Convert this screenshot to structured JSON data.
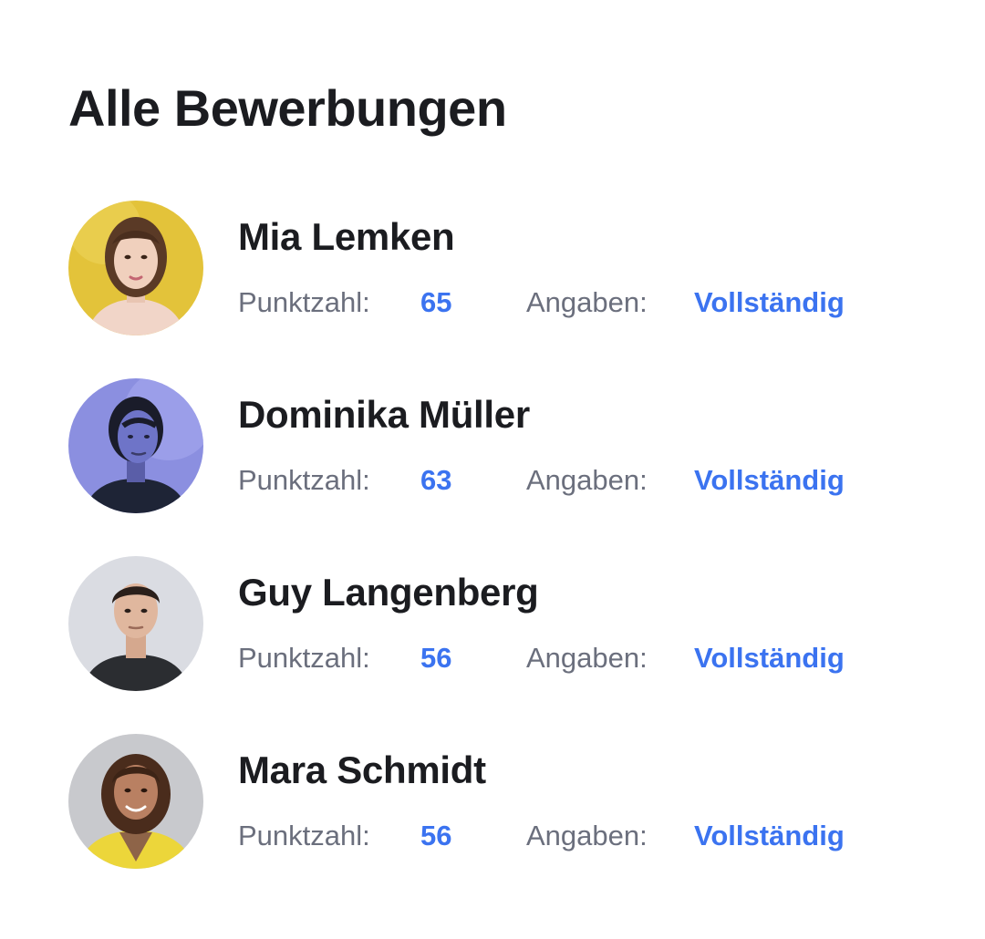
{
  "page_title": "Alle Bewerbungen",
  "colors": {
    "accent": "#3b73f0",
    "label": "#6b6f7d",
    "text": "#1b1c20"
  },
  "applications": [
    {
      "name": "Mia Lemken",
      "score_label": "Punktzahl:",
      "score": "65",
      "info_label": "Angaben:",
      "info_status": "Vollständig"
    },
    {
      "name": "Dominika Müller",
      "score_label": "Punktzahl:",
      "score": "63",
      "info_label": "Angaben:",
      "info_status": "Vollständig"
    },
    {
      "name": "Guy Langenberg",
      "score_label": "Punktzahl:",
      "score": "56",
      "info_label": "Angaben:",
      "info_status": "Vollständig"
    },
    {
      "name": "Mara Schmidt",
      "score_label": "Punktzahl:",
      "score": "56",
      "info_label": "Angaben:",
      "info_status": "Vollständig"
    }
  ]
}
